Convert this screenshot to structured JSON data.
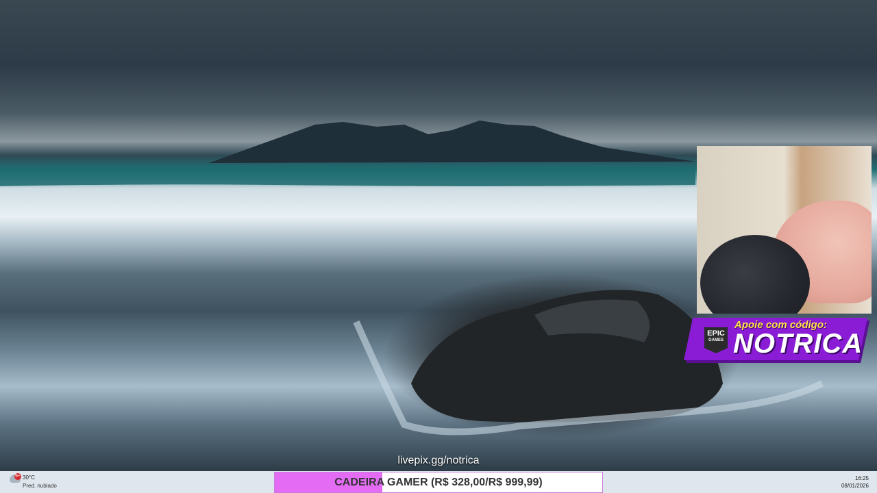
{
  "overlay": {
    "support_label": "Apoie com código:",
    "support_code": "NOTRICA",
    "epic_logo_top": "EPIC",
    "epic_logo_bottom": "GAMES",
    "livepix_url": "livepix.gg/notrica"
  },
  "goal": {
    "label": "CADEIRA GAMER (R$ 328,00/R$ 999,99)",
    "current": 328.0,
    "target": 999.99,
    "progress_fraction": 0.328,
    "fill_color": "#e46cf4"
  },
  "taskbar": {
    "weather_temp": "30°C",
    "weather_desc": "Pred. nublado",
    "weather_badge": "9+",
    "clock_time": "16:25",
    "clock_date": "08/01/2026"
  }
}
